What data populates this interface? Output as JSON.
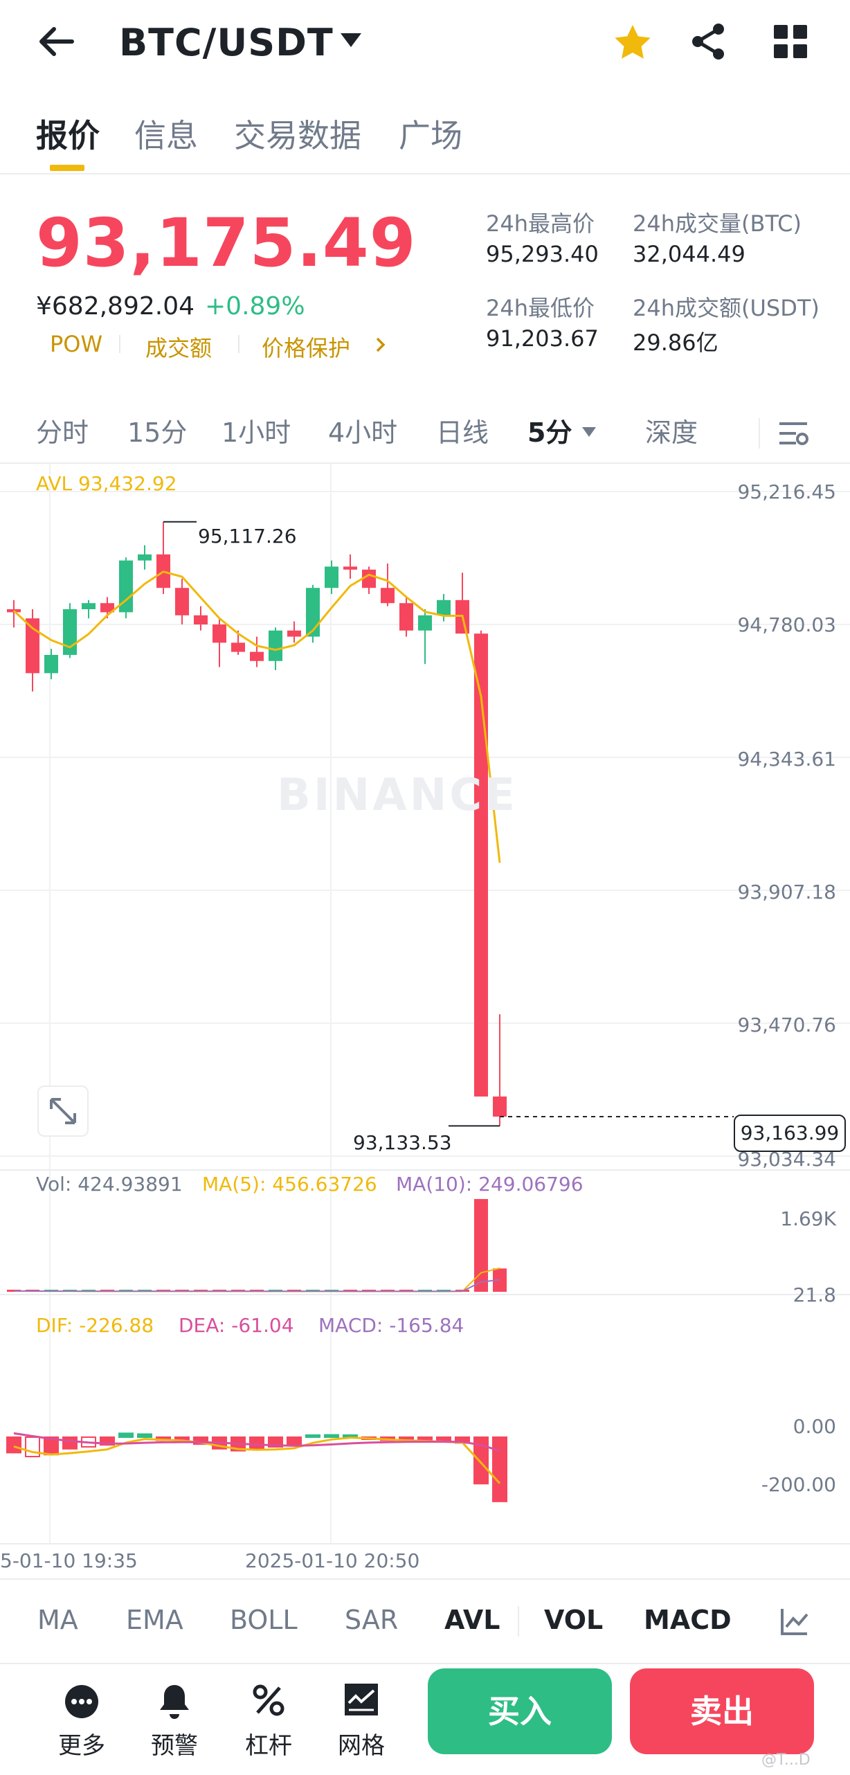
{
  "header": {
    "pair": "BTC/USDT",
    "icons": [
      "back-arrow-icon",
      "dropdown-caret-icon",
      "star-icon",
      "share-icon",
      "grid-icon"
    ],
    "accent_color": "#f0b90b"
  },
  "tabs": [
    "报价",
    "信息",
    "交易数据",
    "广场"
  ],
  "active_tab": "报价",
  "ticker": {
    "price": "93,175.49",
    "cny": "¥682,892.04",
    "change": "+0.89%",
    "tags": [
      "POW",
      "成交额",
      "价格保护"
    ],
    "high_label": "24h最高价",
    "high": "95,293.40",
    "low_label": "24h最低价",
    "low": "91,203.67",
    "vol_btc_label": "24h成交量(BTC)",
    "vol_btc": "32,044.49",
    "vol_usdt_label": "24h成交额(USDT)",
    "vol_usdt": "29.86亿",
    "up_color": "#2ebd85",
    "down_color": "#f6465d"
  },
  "intervals": [
    "分时",
    "15分",
    "1小时",
    "4小时",
    "日线",
    "5分",
    "深度"
  ],
  "active_interval": "5分",
  "chart": {
    "avl_legend": "AVL 93,432.92",
    "price_axis": [
      "95,216.45",
      "94,780.03",
      "94,343.61",
      "93,907.18",
      "93,470.76",
      "93,034.34"
    ],
    "high_annotation": "95,117.26",
    "low_annotation": "93,133.53",
    "last_price_tag": "93,163.99",
    "watermark": "BINANCE",
    "vol_legend": "Vol: 424.93891",
    "vol_ma5_legend": "MA(5): 456.63726",
    "vol_ma10_legend": "MA(10): 249.06796",
    "vol_axis": [
      "1.69K",
      "21.8"
    ],
    "macd_dif_legend": "DIF: -226.88",
    "macd_dea_legend": "DEA: -61.04",
    "macd_legend": "MACD: -165.84",
    "macd_axis": [
      "0.00",
      "-200.00"
    ],
    "time_axis": [
      "5-01-10 19:35",
      "2025-01-10 20:50"
    ]
  },
  "chart_data": {
    "type": "candlestick",
    "ylim": [
      93034.34,
      95216.45
    ],
    "candles": [
      {
        "o": 94820,
        "h": 94860,
        "l": 94770,
        "c": 94830,
        "up": false
      },
      {
        "o": 94800,
        "h": 94830,
        "l": 94560,
        "c": 94620,
        "up": false
      },
      {
        "o": 94620,
        "h": 94700,
        "l": 94600,
        "c": 94680,
        "up": true
      },
      {
        "o": 94680,
        "h": 94850,
        "l": 94670,
        "c": 94830,
        "up": true
      },
      {
        "o": 94830,
        "h": 94860,
        "l": 94800,
        "c": 94850,
        "up": true
      },
      {
        "o": 94850,
        "h": 94870,
        "l": 94800,
        "c": 94820,
        "up": false
      },
      {
        "o": 94820,
        "h": 95000,
        "l": 94800,
        "c": 94990,
        "up": true
      },
      {
        "o": 94990,
        "h": 95040,
        "l": 94960,
        "c": 95010,
        "up": true
      },
      {
        "o": 95010,
        "h": 95117,
        "l": 94880,
        "c": 94900,
        "up": false
      },
      {
        "o": 94900,
        "h": 94930,
        "l": 94780,
        "c": 94810,
        "up": false
      },
      {
        "o": 94810,
        "h": 94840,
        "l": 94760,
        "c": 94780,
        "up": false
      },
      {
        "o": 94780,
        "h": 94800,
        "l": 94640,
        "c": 94720,
        "up": false
      },
      {
        "o": 94720,
        "h": 94760,
        "l": 94680,
        "c": 94690,
        "up": false
      },
      {
        "o": 94690,
        "h": 94740,
        "l": 94640,
        "c": 94660,
        "up": false
      },
      {
        "o": 94660,
        "h": 94770,
        "l": 94630,
        "c": 94760,
        "up": true
      },
      {
        "o": 94760,
        "h": 94790,
        "l": 94720,
        "c": 94740,
        "up": false
      },
      {
        "o": 94740,
        "h": 94910,
        "l": 94720,
        "c": 94900,
        "up": true
      },
      {
        "o": 94900,
        "h": 94990,
        "l": 94880,
        "c": 94970,
        "up": true
      },
      {
        "o": 94970,
        "h": 95010,
        "l": 94930,
        "c": 94960,
        "up": false
      },
      {
        "o": 94960,
        "h": 94970,
        "l": 94880,
        "c": 94900,
        "up": false
      },
      {
        "o": 94900,
        "h": 94980,
        "l": 94840,
        "c": 94850,
        "up": false
      },
      {
        "o": 94850,
        "h": 94870,
        "l": 94740,
        "c": 94760,
        "up": false
      },
      {
        "o": 94760,
        "h": 94830,
        "l": 94650,
        "c": 94810,
        "up": true
      },
      {
        "o": 94810,
        "h": 94880,
        "l": 94790,
        "c": 94860,
        "up": true
      },
      {
        "o": 94860,
        "h": 94950,
        "l": 94750,
        "c": 94750,
        "up": false
      },
      {
        "o": 94750,
        "h": 94760,
        "l": 93230,
        "c": 93230,
        "up": false
      },
      {
        "o": 93230,
        "h": 93500,
        "l": 93133.53,
        "c": 93163.99,
        "up": false
      }
    ],
    "volume": [
      14,
      12,
      8,
      10,
      8,
      7,
      9,
      8,
      10,
      9,
      8,
      7,
      8,
      9,
      7,
      8,
      9,
      8,
      7,
      8,
      9,
      7,
      8,
      8,
      20,
      1690,
      425
    ],
    "macd_hist": [
      -40,
      -50,
      -45,
      -30,
      -25,
      -20,
      10,
      8,
      -8,
      -10,
      -18,
      -30,
      -35,
      -30,
      -25,
      -20,
      5,
      6,
      5,
      -5,
      -8,
      -10,
      -10,
      -12,
      -15,
      -120,
      -165.84
    ]
  },
  "indicators": [
    "MA",
    "EMA",
    "BOLL",
    "SAR",
    "AVL",
    "VOL",
    "MACD"
  ],
  "active_indicators": [
    "AVL",
    "VOL",
    "MACD"
  ],
  "bottom_nav": {
    "items": [
      {
        "label": "更多",
        "icon": "more-icon"
      },
      {
        "label": "预警",
        "icon": "bell-icon"
      },
      {
        "label": "杠杆",
        "icon": "leverage-icon"
      },
      {
        "label": "网格",
        "icon": "grid-bot-icon"
      }
    ],
    "buy": "买入",
    "sell": "卖出"
  },
  "corner_watermark": "@T...D"
}
